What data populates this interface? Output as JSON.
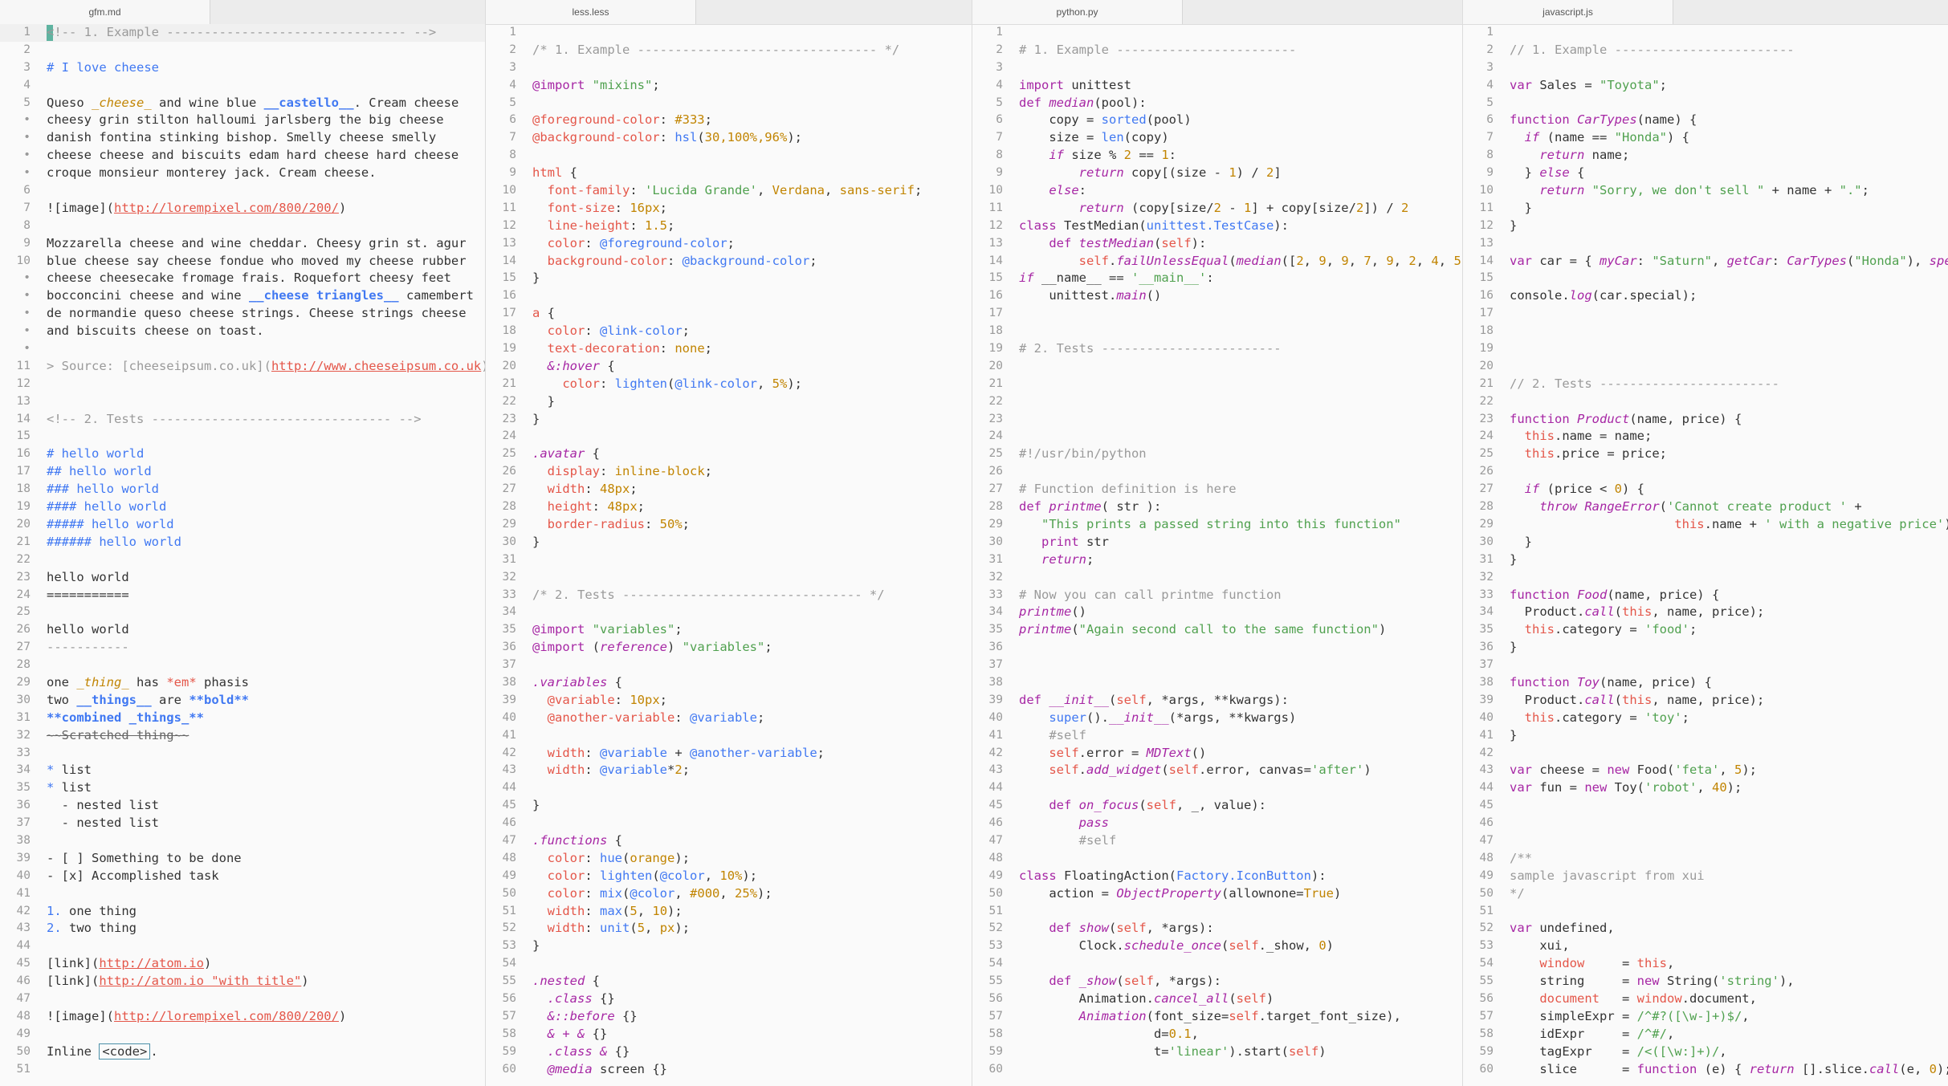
{
  "panes": [
    {
      "tab": "gfm.md",
      "width": 604,
      "lines": [
        "<span class=\"c\">&lt;!-- 1. Example -------------------------------- --&gt;</span>",
        "",
        "<span class=\"h\"># I love cheese</span>",
        "",
        "Queso <span class=\"i\">_cheese_</span> and wine blue <span class=\"b\">__castello__</span>. Cream cheese",
        "cheesy grin stilton halloumi jarlsberg the big cheese",
        "danish fontina stinking bishop. Smelly cheese smelly",
        "cheese cheese and biscuits edam hard cheese hard cheese",
        "croque monsieur monterey jack. Cream cheese.",
        "",
        "![image](<span class=\"u\">http://lorempixel.com/800/200/</span>)",
        "",
        "Mozzarella cheese and wine cheddar. Cheesy grin st. agur",
        "blue cheese say cheese fondue who moved my cheese rubber",
        "cheese cheesecake fromage frais. Roquefort cheesy feet",
        "bocconcini cheese and wine <span class=\"b\">__cheese triangles__</span> camembert",
        "de normandie queso cheese strings. Cheese strings cheese",
        "and biscuits cheese on toast.",
        "",
        "<span class=\"c\">&gt; Source: [cheeseipsum.co.uk](<span class=\"u\">http://www.cheeseipsum.co.uk</span>)</span>",
        "",
        "",
        "<span class=\"c\">&lt;!-- 2. Tests -------------------------------- --&gt;</span>",
        "",
        "<span class=\"h\"># hello world</span>",
        "<span class=\"h\">## hello world</span>",
        "<span class=\"h\">### hello world</span>",
        "<span class=\"h\">#### hello world</span>",
        "<span class=\"h\">##### hello world</span>",
        "<span class=\"h\">###### hello world</span>",
        "",
        "hello world",
        "===========",
        "",
        "hello world",
        "<span class=\"c\">-----------</span>",
        "",
        "one <span class=\"i\">_thing_</span> has <span class=\"v\">*em*</span> phasis",
        "two <span class=\"b\">__things__</span> are <span class=\"b\">**bold**</span>",
        "<span class=\"b\">**combined _things_**</span>",
        "<span class=\"st\">~~Scratched thing~~</span>",
        "",
        "<span class=\"f\">*</span> list",
        "<span class=\"f\">*</span> list",
        "  - nested list",
        "  - nested list",
        "",
        "- [ ] Something to be done",
        "- [x] Accomplished task",
        "",
        "<span class=\"f\">1.</span> one thing",
        "<span class=\"f\">2.</span> two thing",
        "",
        "[link](<span class=\"u\">http://atom.io</span>)",
        "[link](<span class=\"u\">http://atom.io \"with title\"</span>)",
        "",
        "![image](<span class=\"u\">http://lorempixel.com/800/200/</span>)",
        "",
        "Inline <span class=\"codebox\">&lt;code&gt;</span>."
      ],
      "line_numbers": [
        "1",
        "2",
        "3",
        "4",
        "5",
        "•",
        "•",
        "•",
        "•",
        "6",
        "7",
        "8",
        "9",
        "10",
        "•",
        "•",
        "•",
        "•",
        "•",
        "11",
        "12",
        "13",
        "14",
        "15",
        "16",
        "17",
        "18",
        "19",
        "20",
        "21",
        "22",
        "23",
        "24",
        "25",
        "26",
        "27",
        "28",
        "29",
        "30",
        "31",
        "32",
        "33",
        "34",
        "35",
        "36",
        "37",
        "38",
        "39",
        "40",
        "41",
        "42",
        "43",
        "44",
        "45",
        "46",
        "47",
        "48",
        "49",
        "50",
        "51"
      ]
    },
    {
      "tab": "less.less",
      "width": 605,
      "lines": [
        "",
        "<span class=\"c\">/* 1. Example -------------------------------- */</span>",
        "",
        "<span class=\"k\">@import</span> <span class=\"s\">\"mixins\"</span>;",
        "",
        "<span class=\"v\">@foreground-color</span>: <span class=\"n\">#333</span>;",
        "<span class=\"v\">@background-color</span>: <span class=\"f\">hsl</span>(<span class=\"n\">30,100%,96%</span>);",
        "",
        "<span class=\"v\">html</span> {",
        "  <span class=\"v\">font-family</span>: <span class=\"s\">'Lucida Grande'</span>, <span class=\"n\">Verdana</span>, <span class=\"n\">sans-serif</span>;",
        "  <span class=\"v\">font-size</span>: <span class=\"n\">16px</span>;",
        "  <span class=\"v\">line-height</span>: <span class=\"n\">1.5</span>;",
        "  <span class=\"v\">color</span>: <span class=\"f\">@foreground-color</span>;",
        "  <span class=\"v\">background-color</span>: <span class=\"f\">@background-color</span>;",
        "}",
        "",
        "<span class=\"v\">a</span> {",
        "  <span class=\"v\">color</span>: <span class=\"f\">@link-color</span>;",
        "  <span class=\"v\">text-decoration</span>: <span class=\"n\">none</span>;",
        "  <span class=\"kw\">&amp;:hover</span> {",
        "    <span class=\"v\">color</span>: <span class=\"f\">lighten</span>(<span class=\"f\">@link-color</span>, <span class=\"n\">5%</span>);",
        "  }",
        "}",
        "",
        "<span class=\"kw\">.avatar</span> {",
        "  <span class=\"v\">display</span>: <span class=\"n\">inline-block</span>;",
        "  <span class=\"v\">width</span>: <span class=\"n\">48px</span>;",
        "  <span class=\"v\">height</span>: <span class=\"n\">48px</span>;",
        "  <span class=\"v\">border-radius</span>: <span class=\"n\">50%</span>;",
        "}",
        "",
        "",
        "<span class=\"c\">/* 2. Tests -------------------------------- */</span>",
        "",
        "<span class=\"k\">@import</span> <span class=\"s\">\"variables\"</span>;",
        "<span class=\"k\">@import</span> (<span class=\"kw\">reference</span>) <span class=\"s\">\"variables\"</span>;",
        "",
        "<span class=\"kw\">.variables</span> {",
        "  <span class=\"v\">@variable</span>: <span class=\"n\">10px</span>;",
        "  <span class=\"v\">@another-variable</span>: <span class=\"f\">@variable</span>;",
        "",
        "  <span class=\"v\">width</span>: <span class=\"f\">@variable</span> + <span class=\"f\">@another-variable</span>;",
        "  <span class=\"v\">width</span>: <span class=\"f\">@variable</span>*<span class=\"n\">2</span>;",
        "",
        "}",
        "",
        "<span class=\"kw\">.functions</span> {",
        "  <span class=\"v\">color</span>: <span class=\"f\">hue</span>(<span class=\"n\">orange</span>);",
        "  <span class=\"v\">color</span>: <span class=\"f\">lighten</span>(<span class=\"f\">@color</span>, <span class=\"n\">10%</span>);",
        "  <span class=\"v\">color</span>: <span class=\"f\">mix</span>(<span class=\"f\">@color</span>, <span class=\"n\">#000</span>, <span class=\"n\">25%</span>);",
        "  <span class=\"v\">width</span>: <span class=\"f\">max</span>(<span class=\"n\">5</span>, <span class=\"n\">10</span>);",
        "  <span class=\"v\">width</span>: <span class=\"f\">unit</span>(<span class=\"n\">5</span>, <span class=\"n\">px</span>);",
        "}",
        "",
        "<span class=\"kw\">.nested</span> {",
        "  <span class=\"kw\">.class</span> {}",
        "  <span class=\"kw\">&amp;::before</span> {}",
        "  <span class=\"kw\">&amp; + &amp;</span> {}",
        "  <span class=\"kw\">.class &amp;</span> {}",
        "  <span class=\"kw\">@media</span> screen {}"
      ],
      "line_numbers": [
        "1",
        "2",
        "3",
        "4",
        "5",
        "6",
        "7",
        "8",
        "9",
        "10",
        "11",
        "12",
        "13",
        "14",
        "15",
        "16",
        "17",
        "18",
        "19",
        "20",
        "21",
        "22",
        "23",
        "24",
        "25",
        "26",
        "27",
        "28",
        "29",
        "30",
        "31",
        "32",
        "33",
        "34",
        "35",
        "36",
        "37",
        "38",
        "39",
        "40",
        "41",
        "42",
        "43",
        "44",
        "45",
        "46",
        "47",
        "48",
        "49",
        "50",
        "51",
        "52",
        "53",
        "54",
        "55",
        "56",
        "57",
        "58",
        "59",
        "60"
      ]
    },
    {
      "tab": "python.py",
      "width": 610,
      "lines": [
        "",
        "<span class=\"c\"># 1. Example ------------------------</span>",
        "",
        "<span class=\"k\">import</span> unittest",
        "<span class=\"k\">def</span> <span class=\"kw\">median</span>(pool):",
        "    copy = <span class=\"f\">sorted</span>(pool)",
        "    size = <span class=\"f\">len</span>(copy)",
        "    <span class=\"kw\">if</span> size % <span class=\"n\">2</span> == <span class=\"n\">1</span>:",
        "        <span class=\"kw\">return</span> copy[(size - <span class=\"n\">1</span>) / <span class=\"n\">2</span>]",
        "    <span class=\"kw\">else</span>:",
        "        <span class=\"kw\">return</span> (copy[size/<span class=\"n\">2</span> - <span class=\"n\">1</span>] + copy[size/<span class=\"n\">2</span>]) / <span class=\"n\">2</span>",
        "<span class=\"k\">class</span> TestMedian(<span class=\"f\">unittest.TestCase</span>):",
        "    <span class=\"k\">def</span> <span class=\"kw\">testMedian</span>(<span class=\"v\">self</span>):",
        "        <span class=\"v\">self</span>.<span class=\"kw\">failUnlessEqual</span>(<span class=\"kw\">median</span>([<span class=\"n\">2</span>, <span class=\"n\">9</span>, <span class=\"n\">9</span>, <span class=\"n\">7</span>, <span class=\"n\">9</span>, <span class=\"n\">2</span>, <span class=\"n\">4</span>, <span class=\"n\">5</span>",
        "<span class=\"kw\">if</span> __name__ == <span class=\"s\">'__main__'</span>:",
        "    unittest.<span class=\"kw\">main</span>()",
        "",
        "",
        "<span class=\"c\"># 2. Tests ------------------------</span>",
        "",
        "",
        "",
        "",
        "",
        "<span class=\"c\">#!/usr/bin/python</span>",
        "",
        "<span class=\"c\"># Function definition is here</span>",
        "<span class=\"k\">def</span> <span class=\"kw\">printme</span>( str ):",
        "   <span class=\"s\">\"This prints a passed string into this function\"</span>",
        "   <span class=\"k\">print</span> str",
        "   <span class=\"kw\">return</span>;",
        "",
        "<span class=\"c\"># Now you can call printme function</span>",
        "<span class=\"kw\">printme</span>()",
        "<span class=\"kw\">printme</span>(<span class=\"s\">\"Again second call to the same function\"</span>)",
        "",
        "",
        "",
        "<span class=\"k\">def</span> <span class=\"kw\">__init__</span>(<span class=\"v\">self</span>, *args, **kwargs):",
        "    <span class=\"f\">super</span>().<span class=\"kw\">__init__</span>(*args, **kwargs)",
        "    <span class=\"c\">#self</span>",
        "    <span class=\"v\">self</span>.error = <span class=\"kw\">MDText</span>()",
        "    <span class=\"v\">self</span>.<span class=\"kw\">add_widget</span>(<span class=\"v\">self</span>.error, canvas=<span class=\"s\">'after'</span>)",
        "",
        "    <span class=\"k\">def</span> <span class=\"kw\">on_focus</span>(<span class=\"v\">self</span>, _, value):",
        "        <span class=\"kw\">pass</span>",
        "        <span class=\"c\">#self</span>",
        "",
        "<span class=\"k\">class</span> FloatingAction(<span class=\"f\">Factory.IconButton</span>):",
        "    action = <span class=\"kw\">ObjectProperty</span>(allownone=<span class=\"n\">True</span>)",
        "",
        "    <span class=\"k\">def</span> <span class=\"kw\">show</span>(<span class=\"v\">self</span>, *args):",
        "        Clock.<span class=\"kw\">schedule_once</span>(<span class=\"v\">self</span>._show, <span class=\"n\">0</span>)",
        "",
        "    <span class=\"k\">def</span> <span class=\"kw\">_show</span>(<span class=\"v\">self</span>, *args):",
        "        Animation.<span class=\"kw\">cancel_all</span>(<span class=\"v\">self</span>)",
        "        <span class=\"kw\">Animation</span>(font_size=<span class=\"v\">self</span>.target_font_size),",
        "                  d=<span class=\"n\">0.1</span>,",
        "                  t=<span class=\"s\">'linear'</span>).start(<span class=\"v\">self</span>)",
        ""
      ],
      "line_numbers": [
        "1",
        "2",
        "3",
        "4",
        "5",
        "6",
        "7",
        "8",
        "9",
        "10",
        "11",
        "12",
        "13",
        "14",
        "15",
        "16",
        "17",
        "18",
        "19",
        "20",
        "21",
        "22",
        "23",
        "24",
        "25",
        "26",
        "27",
        "28",
        "29",
        "30",
        "31",
        "32",
        "33",
        "34",
        "35",
        "36",
        "37",
        "38",
        "39",
        "40",
        "41",
        "42",
        "43",
        "44",
        "45",
        "46",
        "47",
        "48",
        "49",
        "50",
        "51",
        "52",
        "53",
        "54",
        "55",
        "56",
        "57",
        "58",
        "59",
        "60"
      ]
    },
    {
      "tab": "javascript.js",
      "width": 604,
      "lines": [
        "",
        "<span class=\"c\">// 1. Example ------------------------</span>",
        "",
        "<span class=\"k\">var</span> Sales = <span class=\"s\">\"Toyota\"</span>;",
        "",
        "<span class=\"k\">function</span> <span class=\"kw\">CarTypes</span>(name) {",
        "  <span class=\"kw\">if</span> (name == <span class=\"s\">\"Honda\"</span>) {",
        "    <span class=\"kw\">return</span> name;",
        "  } <span class=\"kw\">else</span> {",
        "    <span class=\"kw\">return</span> <span class=\"s\">\"Sorry, we don't sell \"</span> + name + <span class=\"s\">\".\"</span>;",
        "  }",
        "}",
        "",
        "<span class=\"k\">var</span> car = { <span class=\"kw\">myCar</span>: <span class=\"s\">\"Saturn\"</span>, <span class=\"kw\">getCar</span>: <span class=\"kw\">CarTypes</span>(<span class=\"s\">\"Honda\"</span>), <span class=\"kw\">spe</span>",
        "",
        "console.<span class=\"kw\">log</span>(car.special);",
        "",
        "",
        "",
        "",
        "<span class=\"c\">// 2. Tests ------------------------</span>",
        "",
        "<span class=\"k\">function</span> <span class=\"kw\">Product</span>(name, price) {",
        "  <span class=\"v\">this</span>.name = name;",
        "  <span class=\"v\">this</span>.price = price;",
        "",
        "  <span class=\"kw\">if</span> (price &lt; <span class=\"n\">0</span>) {",
        "    <span class=\"kw\">throw</span> <span class=\"kw\">RangeError</span>(<span class=\"s\">'Cannot create product '</span> +",
        "                      <span class=\"v\">this</span>.name + <span class=\"s\">' with a negative price'</span>)",
        "  }",
        "}",
        "",
        "<span class=\"k\">function</span> <span class=\"kw\">Food</span>(name, price) {",
        "  Product.<span class=\"kw\">call</span>(<span class=\"v\">this</span>, name, price);",
        "  <span class=\"v\">this</span>.category = <span class=\"s\">'food'</span>;",
        "}",
        "",
        "<span class=\"k\">function</span> <span class=\"kw\">Toy</span>(name, price) {",
        "  Product.<span class=\"kw\">call</span>(<span class=\"v\">this</span>, name, price);",
        "  <span class=\"v\">this</span>.category = <span class=\"s\">'toy'</span>;",
        "}",
        "",
        "<span class=\"k\">var</span> cheese = <span class=\"k\">new</span> Food(<span class=\"s\">'feta'</span>, <span class=\"n\">5</span>);",
        "<span class=\"k\">var</span> fun = <span class=\"k\">new</span> Toy(<span class=\"s\">'robot'</span>, <span class=\"n\">40</span>);",
        "",
        "",
        "",
        "<span class=\"c\">/**</span>",
        "<span class=\"c\">sample javascript from xui</span>",
        "<span class=\"c\">*/</span>",
        "",
        "<span class=\"k\">var</span> undefined,",
        "    xui,",
        "    <span class=\"v\">window</span>     = <span class=\"v\">this</span>,",
        "    string     = <span class=\"k\">new</span> String(<span class=\"s\">'string'</span>),",
        "    <span class=\"v\">document</span>   = <span class=\"v\">window</span>.document,",
        "    simpleExpr = <span class=\"s\">/^#?([\\w-]+)$/</span>,",
        "    idExpr     = <span class=\"s\">/^#/</span>,",
        "    tagExpr    = <span class=\"s\">/&lt;([\\w:]+)/</span>,",
        "    slice      = <span class=\"k\">function</span> (e) { <span class=\"kw\">return</span> [].slice.<span class=\"kw\">call</span>(e, <span class=\"n\">0</span>);"
      ],
      "line_numbers": [
        "1",
        "2",
        "3",
        "4",
        "5",
        "6",
        "7",
        "8",
        "9",
        "10",
        "11",
        "12",
        "13",
        "14",
        "15",
        "16",
        "17",
        "18",
        "19",
        "20",
        "21",
        "22",
        "23",
        "24",
        "25",
        "26",
        "27",
        "28",
        "29",
        "30",
        "31",
        "32",
        "33",
        "34",
        "35",
        "36",
        "37",
        "38",
        "39",
        "40",
        "41",
        "42",
        "43",
        "44",
        "45",
        "46",
        "47",
        "48",
        "49",
        "50",
        "51",
        "52",
        "53",
        "54",
        "55",
        "56",
        "57",
        "58",
        "59",
        "60"
      ]
    }
  ],
  "colors": {
    "comment": "#9a9a9a",
    "keyword": "#a626a4",
    "string": "#50a14f",
    "number": "#c18401",
    "function": "#4078f2",
    "variable": "#e45649",
    "cursor": "#5fb3a0"
  }
}
